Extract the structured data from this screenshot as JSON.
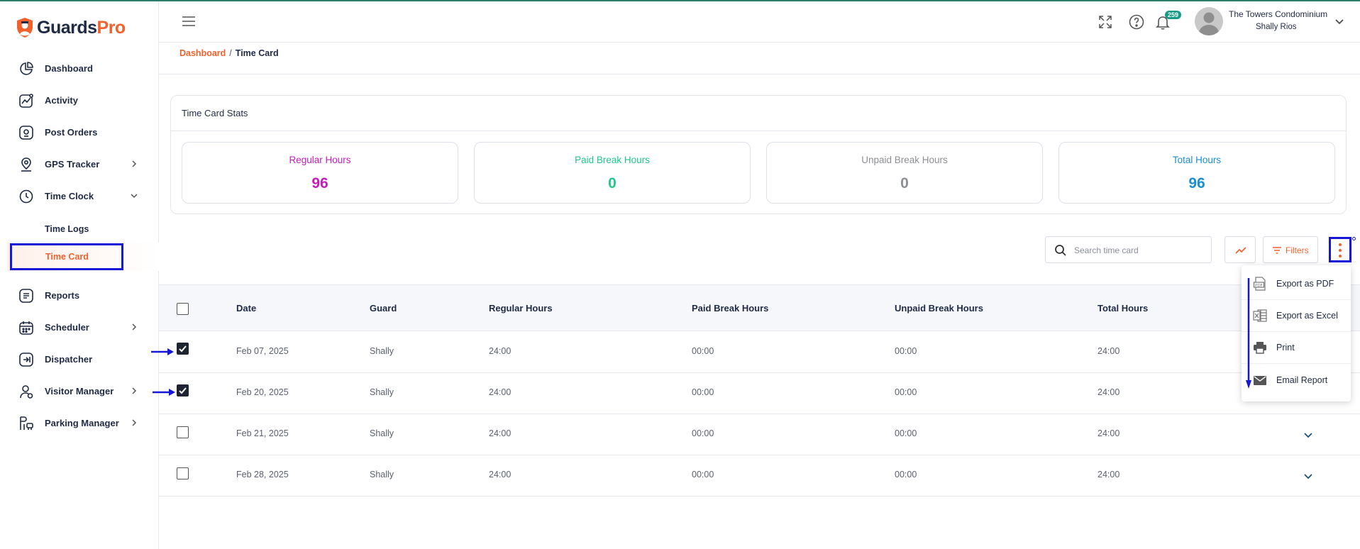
{
  "app": {
    "logo_prefix": "Guards",
    "logo_suffix": "Pro"
  },
  "sidebar": {
    "items": [
      {
        "label": "Dashboard",
        "icon": "dashboard-icon"
      },
      {
        "label": "Activity",
        "icon": "activity-icon"
      },
      {
        "label": "Post Orders",
        "icon": "post-orders-icon"
      },
      {
        "label": "GPS Tracker",
        "icon": "gps-icon"
      },
      {
        "label": "Time Clock",
        "icon": "clock-icon"
      },
      {
        "label": "Reports",
        "icon": "reports-icon"
      },
      {
        "label": "Scheduler",
        "icon": "calendar-icon"
      },
      {
        "label": "Dispatcher",
        "icon": "dispatcher-icon"
      },
      {
        "label": "Visitor Manager",
        "icon": "visitor-icon"
      },
      {
        "label": "Parking Manager",
        "icon": "parking-icon"
      }
    ],
    "sub_items": {
      "time_logs": "Time Logs",
      "time_card": "Time Card"
    }
  },
  "header": {
    "notification_count": "259",
    "org_name": "The Towers Condominium",
    "user_name": "Shally Rios"
  },
  "breadcrumb": {
    "root": "Dashboard",
    "separator": "/",
    "current": "Time Card"
  },
  "stats": {
    "title": "Time Card Stats",
    "cards": [
      {
        "label": "Regular Hours",
        "value": "96",
        "color": "#c41dbb"
      },
      {
        "label": "Paid Break Hours",
        "value": "0",
        "color": "#1ec98a"
      },
      {
        "label": "Unpaid Break Hours",
        "value": "0",
        "color": "#8d8f94"
      },
      {
        "label": "Total Hours",
        "value": "96",
        "color": "#1a8fcf"
      }
    ]
  },
  "toolbar": {
    "search_placeholder": "Search time card",
    "filters_label": "Filters"
  },
  "table": {
    "headers": {
      "date": "Date",
      "guard": "Guard",
      "regular": "Regular Hours",
      "paid": "Paid Break Hours",
      "unpaid": "Unpaid Break Hours",
      "total": "Total Hours"
    },
    "rows": [
      {
        "date": "Feb 07, 2025",
        "guard": "Shally",
        "regular": "24:00",
        "paid": "00:00",
        "unpaid": "00:00",
        "total": "24:00",
        "checked": true
      },
      {
        "date": "Feb 20, 2025",
        "guard": "Shally",
        "regular": "24:00",
        "paid": "00:00",
        "unpaid": "00:00",
        "total": "24:00",
        "checked": true
      },
      {
        "date": "Feb 21, 2025",
        "guard": "Shally",
        "regular": "24:00",
        "paid": "00:00",
        "unpaid": "00:00",
        "total": "24:00",
        "checked": false
      },
      {
        "date": "Feb 28, 2025",
        "guard": "Shally",
        "regular": "24:00",
        "paid": "00:00",
        "unpaid": "00:00",
        "total": "24:00",
        "checked": false
      }
    ]
  },
  "export_menu": {
    "items": [
      {
        "label": "Export as PDF",
        "icon": "pdf-icon"
      },
      {
        "label": "Export as Excel",
        "icon": "excel-icon"
      },
      {
        "label": "Print",
        "icon": "print-icon"
      },
      {
        "label": "Email Report",
        "icon": "email-icon"
      }
    ]
  },
  "annotation_color": "#1616d8",
  "accent_color": "#f0612e"
}
